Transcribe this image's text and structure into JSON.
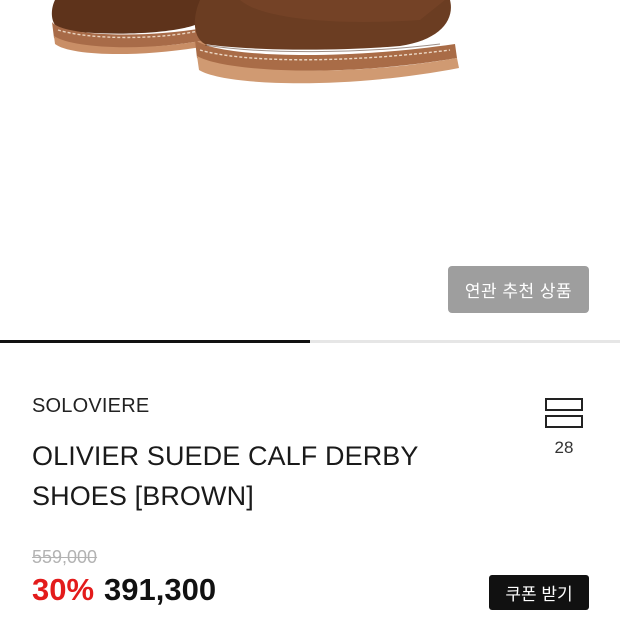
{
  "product_image": {
    "alt": "brown suede derby shoes"
  },
  "related_button": {
    "label": "연관 추천 상품"
  },
  "image_progress": {
    "fraction": 0.5
  },
  "product": {
    "brand": "SOLOVIERE",
    "title": "OLIVIER SUEDE CALF DERBY SHOES [BROWN]",
    "like_icon": "bookmark-stack-icon",
    "like_count": "28"
  },
  "pricing": {
    "original_price": "559,000",
    "discount": "30%",
    "sale_price": "391,300"
  },
  "coupon_button": {
    "label": "쿠폰 받기"
  },
  "colors": {
    "accent_discount": "#e31b1b",
    "button_dark": "#111111",
    "button_gray": "#9e9e9e",
    "suede_brown": "#6b3d22"
  }
}
